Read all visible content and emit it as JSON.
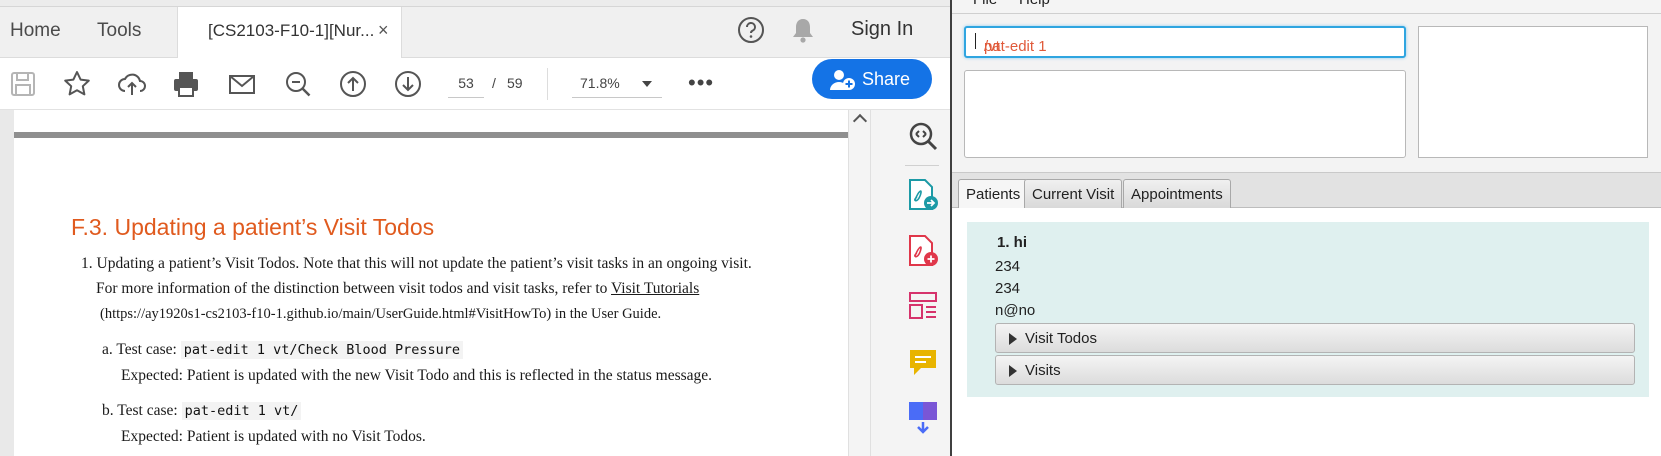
{
  "reader": {
    "menu": {
      "home": "Home",
      "tools": "Tools"
    },
    "tab": {
      "title": "[CS2103-F10-1][Nur...",
      "close": "×"
    },
    "header": {
      "sign_in": "Sign In"
    },
    "toolbar": {
      "page_current": "53",
      "page_sep": "/",
      "page_total": "59",
      "zoom": "71.8%",
      "share": "Share",
      "more": "•••"
    },
    "document": {
      "section_title": "F.3. Updating a patient’s Visit Todos",
      "item1_line1": "1. Updating a patient’s Visit Todos. Note that this will not update the patient’s visit tasks in an ongoing visit.",
      "item1_line2_pre": "For more information of the distinction between visit todos and visit tasks, refer to ",
      "item1_link": "Visit Tutorials",
      "item1_line3": "(https://ay1920s1-cs2103-f10-1.github.io/main/UserGuide.html#VisitHowTo) in the User Guide.",
      "case_a_prefix": "a. Test case: ",
      "case_a_code": "pat-edit 1 vt/Check Blood Pressure",
      "case_a_expected": "Expected: Patient is updated with the new Visit Todo and this is reflected in the status message.",
      "case_b_prefix": "b. Test case: ",
      "case_b_code": "pat-edit 1 vt/",
      "case_b_expected": "Expected: Patient is updated with no Visit Todos."
    }
  },
  "app": {
    "menu": {
      "file": "File",
      "help": "Help"
    },
    "command_before_caret": "pat-edit 1 ",
    "command_after_caret": "/vt",
    "tabs": [
      "Patients",
      "Current Visit",
      "Appointments"
    ],
    "patient": {
      "name": "1.  hi",
      "phone": "234",
      "address": "234",
      "email": "n@no",
      "visit_todos": "Visit Todos",
      "visits": "Visits"
    }
  },
  "colors": {
    "accent_blue": "#1473e6",
    "heading_orange": "#e05a1e",
    "command_text": "#e05a3a",
    "card_background": "#dff0ef"
  }
}
